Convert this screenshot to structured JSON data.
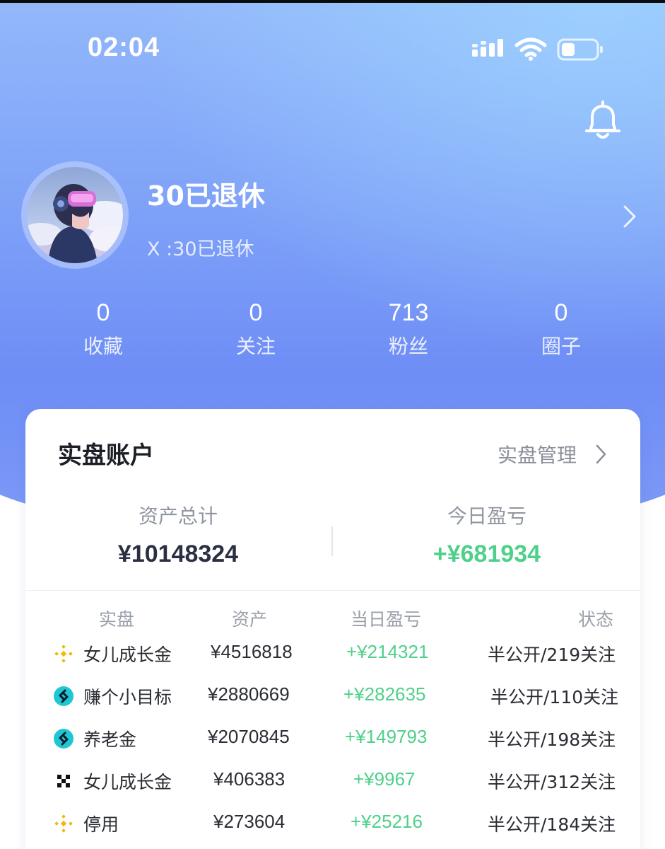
{
  "status_bar": {
    "time": "02:04",
    "icons": [
      "signal-icon",
      "wifi-icon",
      "battery-icon"
    ]
  },
  "header": {
    "bell_icon": "bell-icon"
  },
  "profile": {
    "name": "30已退休",
    "handle": "X :30已退休",
    "avatar": "avatar-illustration"
  },
  "stats": [
    {
      "value": "0",
      "label": "收藏"
    },
    {
      "value": "0",
      "label": "关注"
    },
    {
      "value": "713",
      "label": "粉丝"
    },
    {
      "value": "0",
      "label": "圈子"
    }
  ],
  "account_card": {
    "title": "实盘账户",
    "manage_label": "实盘管理",
    "total_assets_label": "资产总计",
    "total_assets_value": "¥10148324",
    "today_pnl_label": "今日盈亏",
    "today_pnl_value": "+¥681934",
    "columns": [
      "实盘",
      "资产",
      "当日盈亏",
      "状态"
    ],
    "rows": [
      {
        "icon": "binance-icon",
        "name": "女儿成长金",
        "assets": "¥4516818",
        "pnl": "+¥214321",
        "status": "半公开/219关注"
      },
      {
        "icon": "bitget-icon",
        "name": "赚个小目标",
        "assets": "¥2880669",
        "pnl": "+¥282635",
        "status": "半公开/110关注"
      },
      {
        "icon": "bitget-icon",
        "name": "养老金",
        "assets": "¥2070845",
        "pnl": "+¥149793",
        "status": "半公开/198关注"
      },
      {
        "icon": "okx-icon",
        "name": "女儿成长金",
        "assets": "¥406383",
        "pnl": "+¥9967",
        "status": "半公开/312关注"
      },
      {
        "icon": "binance-icon",
        "name": "停用",
        "assets": "¥273604",
        "pnl": "+¥25216",
        "status": "半公开/184关注"
      }
    ]
  },
  "colors": {
    "header_gradient_top": "#93b8fb",
    "header_gradient_bottom": "#6e8df6",
    "profit_green": "#4fd08a",
    "binance_yellow": "#f0b90b",
    "bitget_cyan": "#1fc7d4",
    "text_dark": "#1c1f26",
    "text_muted": "#9096a0"
  }
}
